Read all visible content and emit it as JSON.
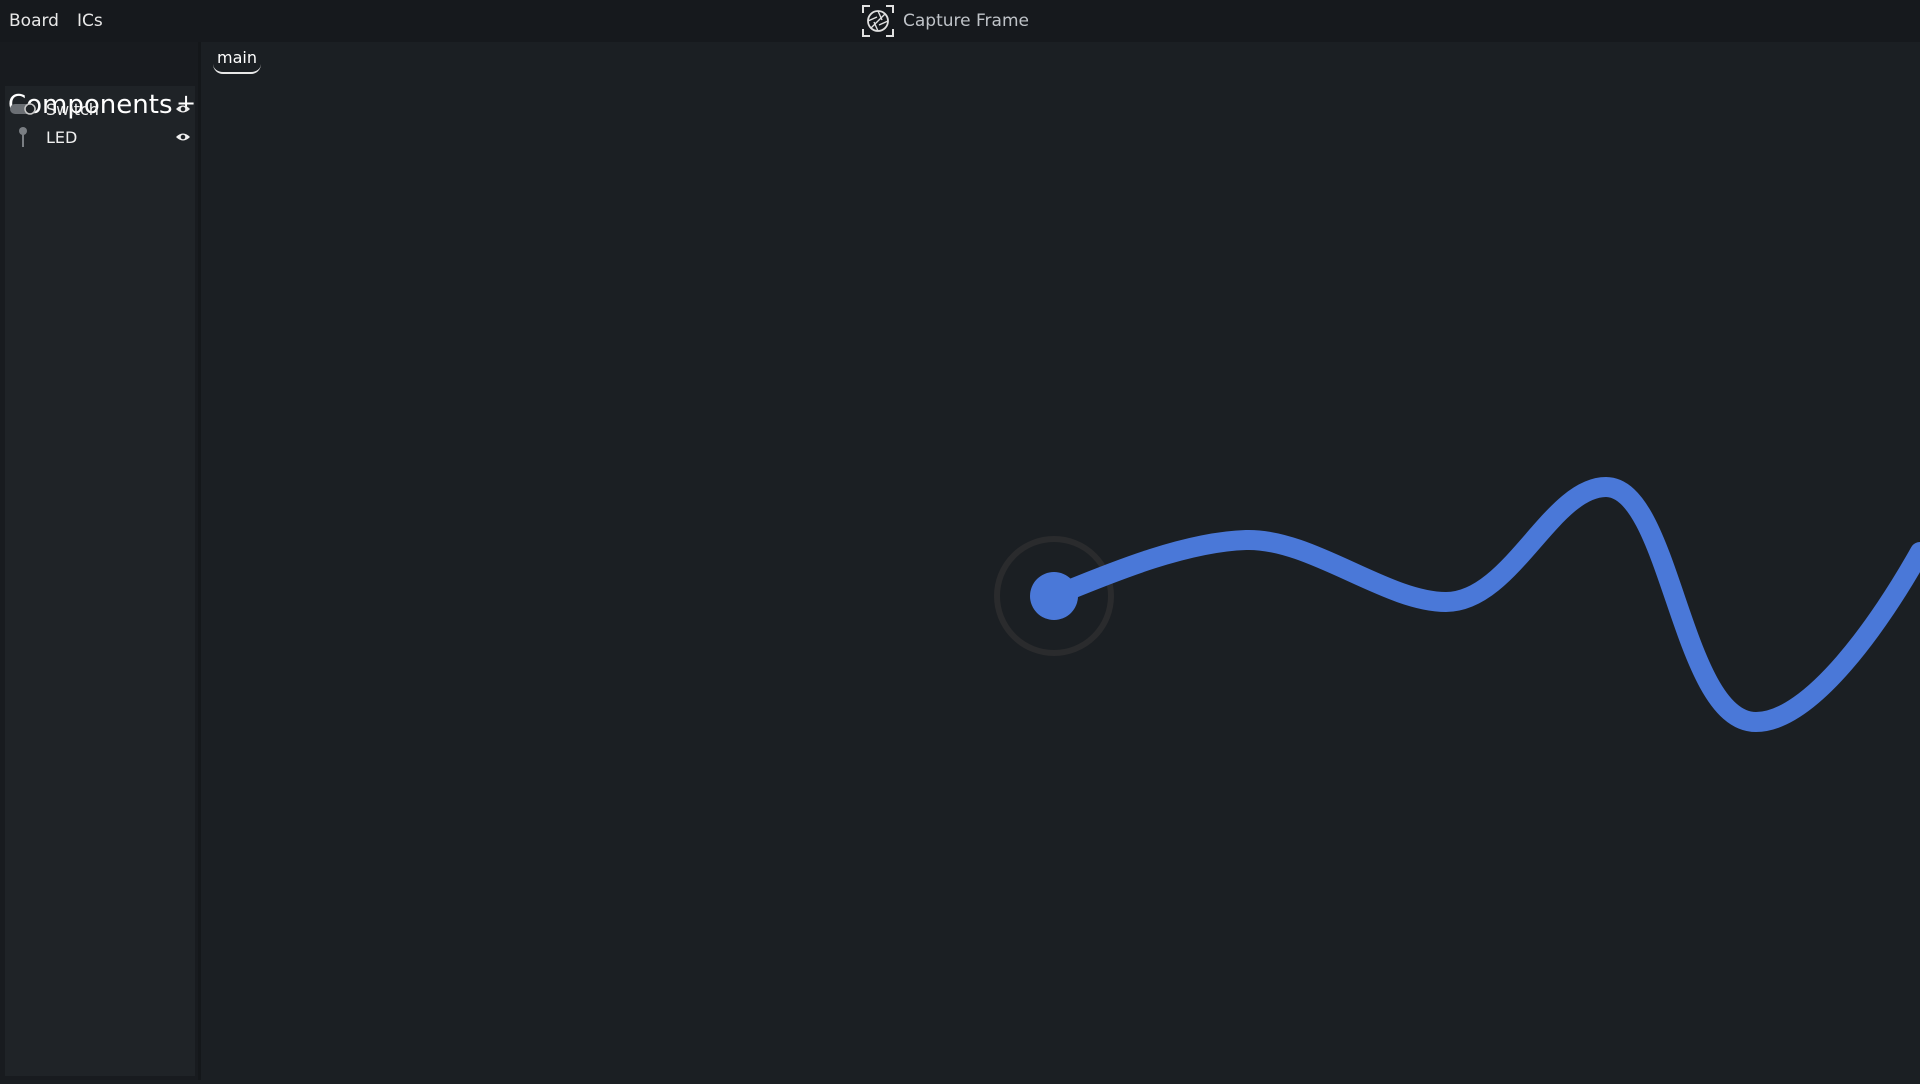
{
  "menu": {
    "board": "Board",
    "ics": "ICs"
  },
  "capture": {
    "label": "Capture Frame",
    "icon": "camera-aperture-icon"
  },
  "sidebar": {
    "title": "Components",
    "add_icon": "plus-icon",
    "items": [
      {
        "label": "Switch",
        "icon": "switch-icon",
        "visibility_icon": "eye-icon"
      },
      {
        "label": "LED",
        "icon": "led-icon",
        "visibility_icon": "eye-icon"
      }
    ]
  },
  "tabs": [
    {
      "label": "main",
      "active": true
    }
  ],
  "canvas": {
    "wire_color": "#4a78d8",
    "background": "#1b1f23"
  }
}
